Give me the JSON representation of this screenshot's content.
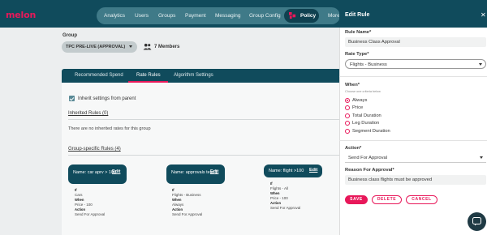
{
  "app": {
    "logo": "melon"
  },
  "nav": {
    "items": [
      "Analytics",
      "Users",
      "Groups",
      "Payment",
      "Messaging",
      "Group Config"
    ],
    "active": "Policy",
    "more": "More"
  },
  "group": {
    "label": "Group",
    "selected": "TPC PRE-LIVE (APPROVAL)",
    "members": "7 Members"
  },
  "tabs": [
    "Recommended Spend",
    "Rate Rules",
    "Algorithm Settings"
  ],
  "inherit": {
    "checkbox_label": "Inherit settings from parent",
    "inherited_title": "Inherited Rules (0)",
    "inherited_empty": "There are no inherited rates for this group",
    "group_title": "Group-specific Rules (4)"
  },
  "rules": [
    {
      "name": "Name: car aprv > 100",
      "edit": "Edit",
      "if_label": "If",
      "if_value": "Cars",
      "when_label": "When",
      "when_value": "Price - 100",
      "action_label": "Action",
      "action_value": "Send For Approval"
    },
    {
      "name": "Name: approvals test-1",
      "edit": "Edit",
      "if_label": "If",
      "if_value": "Flights - Business",
      "when_label": "When",
      "when_value": "Always",
      "action_label": "Action",
      "action_value": "Send For Approval"
    },
    {
      "name": "Name: flight >100",
      "edit": "Edit",
      "if_label": "If",
      "if_value": "Flights - All",
      "when_label": "When",
      "when_value": "Price - 100",
      "action_label": "Action",
      "action_value": "Send For Approval"
    }
  ],
  "panel": {
    "title": "Edit Rule",
    "rule_name_label": "Rule Name*",
    "rule_name_value": "Business Class Approval",
    "rule_type_label": "Rate Type*",
    "rule_type_value": "Flights - Business",
    "when_label": "When*",
    "when_hint": "Choose one criteria below",
    "when_options": [
      "Always",
      "Price",
      "Total Duration",
      "Leg Duration",
      "Segment Duration"
    ],
    "when_selected": "Always",
    "action_label": "Action*",
    "action_value": "Send For Approval",
    "reason_label": "Reason For Approval*",
    "reason_value": "Business class flights must be approved",
    "save": "SAVE",
    "delete": "DELETE",
    "cancel": "CANCEL"
  },
  "colors": {
    "brand": "#e8185a",
    "nav": "#104b5c"
  },
  "icons": {
    "close": "close-icon",
    "policy": "policy-icon",
    "members": "members-icon",
    "chat": "chat-icon"
  }
}
